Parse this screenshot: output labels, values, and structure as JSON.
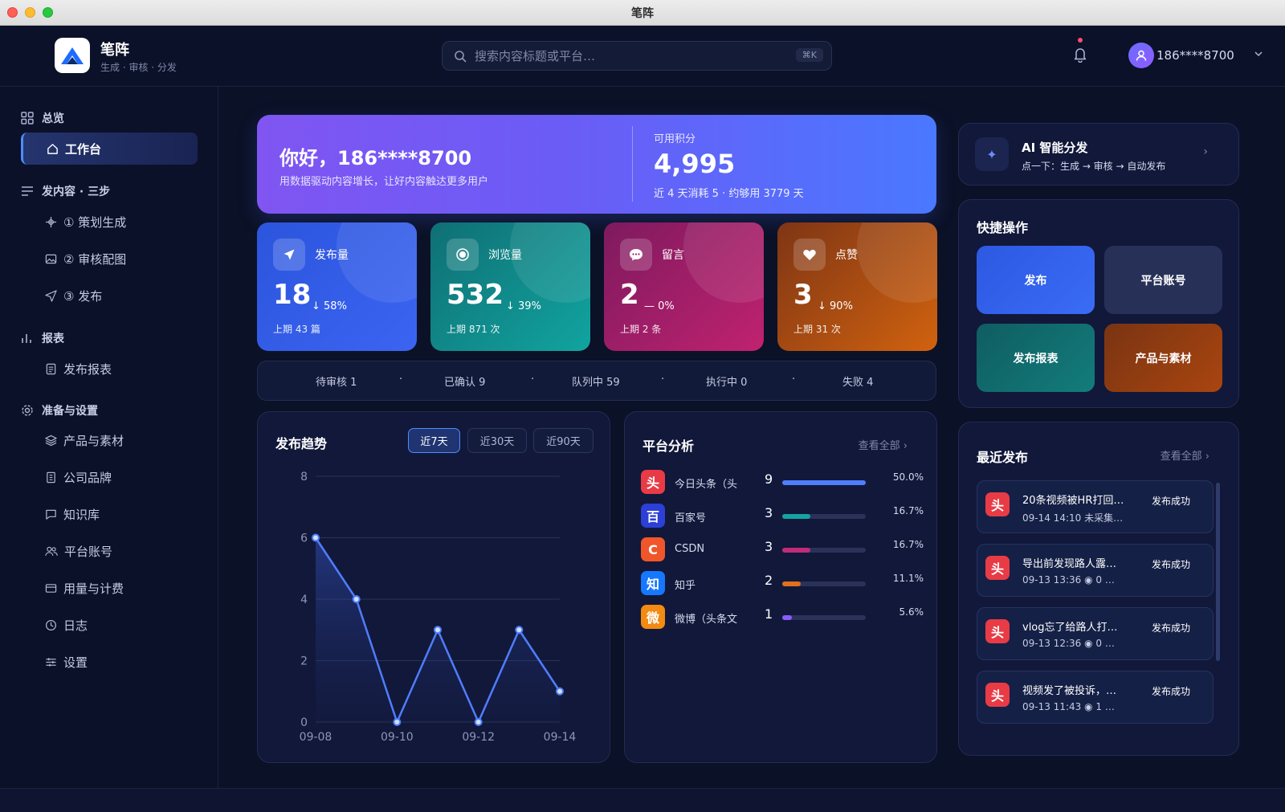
{
  "window": {
    "title": "笔阵"
  },
  "header": {
    "brand_name": "笔阵",
    "brand_sub": "生成 · 审核 · 分发",
    "search_placeholder": "搜索内容标题或平台…",
    "search_shortcut": "⌘K",
    "user_name": "186****8700"
  },
  "sidebar": {
    "group_overview": "总览",
    "item_workbench": "工作台",
    "group_publish": "发内容 · 三步",
    "item_plan": "① 策划生成",
    "item_review": "② 审核配图",
    "item_publish": "③ 发布",
    "group_reports": "报表",
    "item_report": "发布报表",
    "group_setup": "准备与设置",
    "item_products": "产品与素材",
    "item_brand": "公司品牌",
    "item_kb": "知识库",
    "item_accounts": "平台账号",
    "item_billing": "用量与计费",
    "item_logs": "日志",
    "item_settings": "设置"
  },
  "hero": {
    "greeting": "你好，186****8700",
    "subtitle": "用数据驱动内容增长，让好内容触达更多用户",
    "points_label": "可用积分",
    "points_value": "4,995",
    "points_note": "近 4 天消耗 5 · 约够用 3779 天"
  },
  "stats": [
    {
      "label": "发布量",
      "value": "18",
      "change": "↓ 58%",
      "prev": "上期 43 篇"
    },
    {
      "label": "浏览量",
      "value": "532",
      "change": "↓ 39%",
      "prev": "上期 871 次"
    },
    {
      "label": "留言",
      "value": "2",
      "change": "— 0%",
      "prev": "上期 2 条"
    },
    {
      "label": "点赞",
      "value": "3",
      "change": "↓ 90%",
      "prev": "上期 31 次"
    }
  ],
  "status_bar": {
    "pending": "待审核 1",
    "confirmed": "已确认 9",
    "queued": "队列中 59",
    "running": "执行中 0",
    "failed": "失败 4",
    "separator": "·"
  },
  "trend": {
    "title": "发布趋势",
    "ranges": [
      "近7天",
      "近30天",
      "近90天"
    ],
    "active_range": 0
  },
  "chart_data": {
    "type": "area",
    "x": [
      "09-08",
      "09-09",
      "09-10",
      "09-11",
      "09-12",
      "09-13",
      "09-14"
    ],
    "values": [
      6,
      4,
      0,
      3,
      0,
      3,
      1
    ],
    "x_tick_labels": [
      "09-08",
      "09-10",
      "09-12",
      "09-14"
    ],
    "y_ticks": [
      "0",
      "2",
      "4",
      "6",
      "8"
    ],
    "ylim": [
      0,
      8
    ],
    "grid": true,
    "color": "#4f7dff"
  },
  "platform": {
    "title": "平台分析",
    "view_all": "查看全部 ›",
    "rows": [
      {
        "icon": "头",
        "name": "今日头条（头",
        "count": "9",
        "pct": "50.0%",
        "fraction": 1.0,
        "color": "#4f7dff",
        "icon_bg": "#e83b46"
      },
      {
        "icon": "百",
        "name": "百家号",
        "count": "3",
        "pct": "16.7%",
        "fraction": 0.334,
        "color": "#14a3a0",
        "icon_bg": "#2c3fd6"
      },
      {
        "icon": "C",
        "name": "CSDN",
        "count": "3",
        "pct": "16.7%",
        "fraction": 0.334,
        "color": "#c22a7a",
        "icon_bg": "#f0562a"
      },
      {
        "icon": "知",
        "name": "知乎",
        "count": "2",
        "pct": "11.1%",
        "fraction": 0.222,
        "color": "#e0701a",
        "icon_bg": "#1677ff"
      },
      {
        "icon": "微",
        "name": "微博（头条文",
        "count": "1",
        "pct": "5.6%",
        "fraction": 0.112,
        "color": "#8a5cff",
        "icon_bg": "#f38a12"
      }
    ]
  },
  "ai_card": {
    "title": "AI 智能分发",
    "subtitle": "点一下：生成 → 审核 → 自动发布",
    "arrow": "›"
  },
  "quick": {
    "title": "快捷操作",
    "buttons": [
      "发布",
      "平台账号",
      "发布报表",
      "产品与素材"
    ]
  },
  "recent": {
    "title": "最近发布",
    "view_all": "查看全部 ›",
    "items": [
      {
        "icon": "头",
        "title": "20条视频被HR打回…",
        "meta": "09-14 14:10   未采集…",
        "status": "发布成功"
      },
      {
        "icon": "头",
        "title": "导出前发现路人露…",
        "meta": "09-13 13:36   ◉ 0   …",
        "status": "发布成功"
      },
      {
        "icon": "头",
        "title": "vlog忘了给路人打…",
        "meta": "09-13 12:36   ◉ 0   …",
        "status": "发布成功"
      },
      {
        "icon": "头",
        "title": "视频发了被投诉，…",
        "meta": "09-13 11:43   ◉ 1   …",
        "status": "发布成功"
      }
    ]
  },
  "colors": {
    "background": "#0b1126",
    "accent": "#4f8cff",
    "panel": "#11183a"
  }
}
